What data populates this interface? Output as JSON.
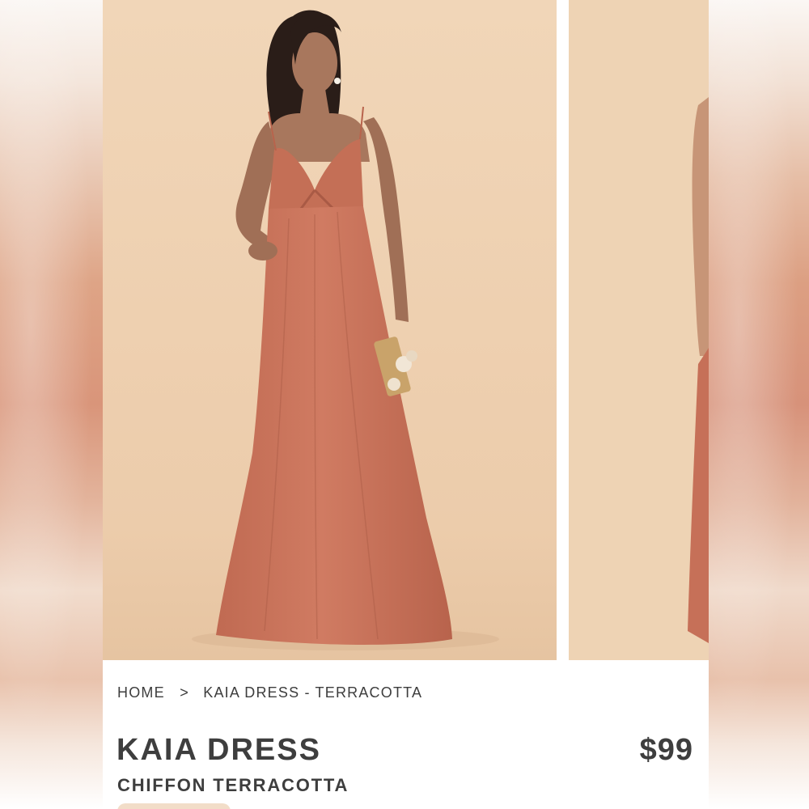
{
  "breadcrumb": {
    "home": "HOME",
    "separator": ">",
    "current": "KAIA DRESS - TERRACOTTA"
  },
  "product": {
    "name": "KAIA DRESS",
    "variant": "CHIFFON TERRACOTTA",
    "price": "$99"
  },
  "gallery": {
    "images": [
      {
        "alt": "model-in-dress-front-icon"
      },
      {
        "alt": "model-in-dress-side-icon"
      }
    ]
  },
  "colors": {
    "dress": "#c9735b",
    "backdrop": "#efd3b5",
    "text": "#3e3e3e"
  }
}
